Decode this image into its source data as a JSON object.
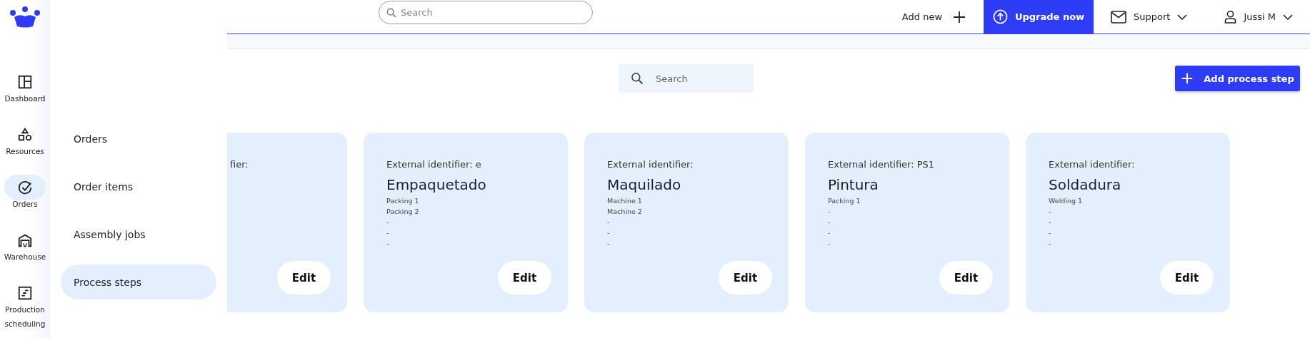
{
  "rail": [
    {
      "label": "Dashboard",
      "kind": "dashboard",
      "selected": false
    },
    {
      "label": "Resources",
      "kind": "shapes",
      "selected": false
    },
    {
      "label": "Orders",
      "kind": "check",
      "selected": true
    },
    {
      "label": "Warehouse",
      "kind": "warehouse",
      "selected": false
    },
    {
      "label": "Production scheduling",
      "kind": "schedule",
      "selected": false
    }
  ],
  "submenu": [
    {
      "label": "Orders",
      "selected": false
    },
    {
      "label": "Order items",
      "selected": false
    },
    {
      "label": "Assembly jobs",
      "selected": false
    },
    {
      "label": "Process steps",
      "selected": true
    }
  ],
  "header": {
    "search": {
      "placeholder": "Search"
    },
    "add_new": "Add new",
    "upgrade": "Upgrade now",
    "support": "Support",
    "user": "Jussi M"
  },
  "toolbar": {
    "search": {
      "placeholder": "Search"
    },
    "add_button": "Add process step"
  },
  "cards": [
    {
      "kind": "partial",
      "identifier": "fier:",
      "edit": "Edit"
    },
    {
      "kind": "full",
      "identifier": "External identifier: e",
      "title": "Empaquetado",
      "lines": [
        "Packing 1",
        "Packing 2",
        "-",
        "-",
        "-"
      ],
      "edit": "Edit"
    },
    {
      "kind": "full",
      "identifier": "External identifier:",
      "title": "Maquilado",
      "lines": [
        "Machine 1",
        "Machine 2",
        "-",
        "-",
        "-"
      ],
      "edit": "Edit"
    },
    {
      "kind": "full",
      "identifier": "External identifier: PS1",
      "title": "Pintura",
      "lines": [
        "Packing 1",
        "-",
        "-",
        "-",
        "-"
      ],
      "edit": "Edit"
    },
    {
      "kind": "full",
      "identifier": "External identifier:",
      "title": "Soldadura",
      "lines": [
        "Welding 1",
        "-",
        "-",
        "-",
        "-"
      ],
      "edit": "Edit"
    }
  ]
}
